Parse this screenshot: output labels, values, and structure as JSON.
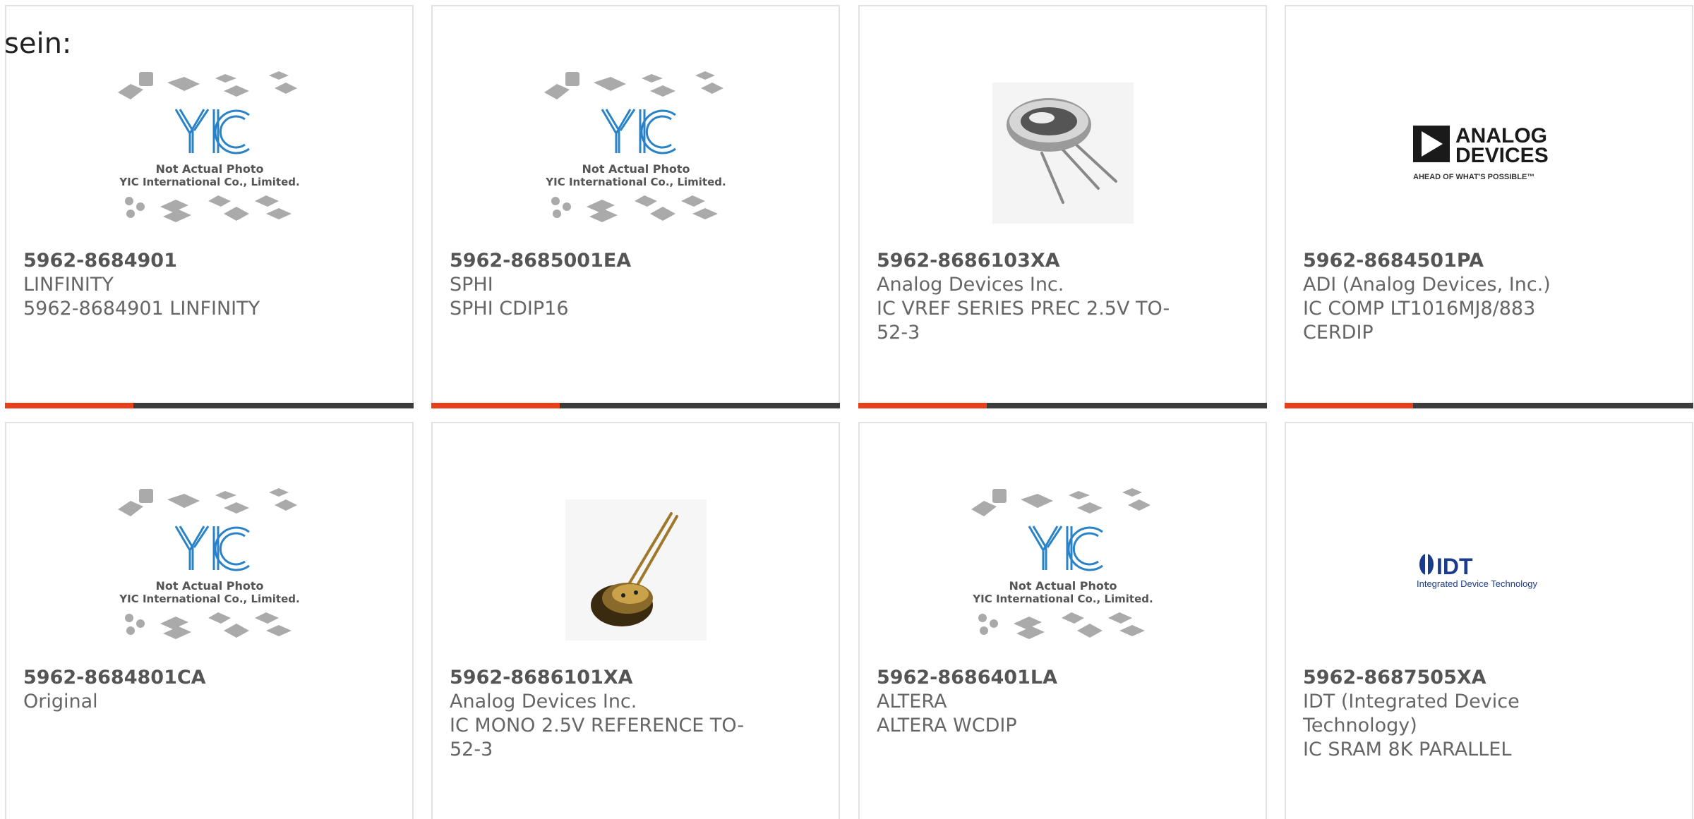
{
  "heading": "sein:",
  "colors": {
    "accent_bar": "#e8401c",
    "dark_bar": "#3c3c3c",
    "yic_blue": "#2a83c7",
    "analog_black": "#1a1a1a",
    "idt_blue": "#1b3c8c"
  },
  "placeholder": {
    "line1": "Not Actual Photo",
    "line2": "YIC International Co., Limited.",
    "logo_text": "YIC"
  },
  "analog_logo": {
    "line1": "ANALOG",
    "line2": "DEVICES",
    "tagline": "AHEAD OF WHAT'S POSSIBLE™"
  },
  "idt_logo": {
    "mark": "IDT",
    "tagline": "Integrated Device Technology"
  },
  "products": [
    {
      "part": "5962-8684901",
      "mfr": "LINFINITY",
      "desc": "5962-8684901 LINFINITY",
      "image": "placeholder-icon"
    },
    {
      "part": "5962-8685001EA",
      "mfr": "SPHI",
      "desc": "SPHI CDIP16",
      "image": "placeholder-icon"
    },
    {
      "part": "5962-8686103XA",
      "mfr": "Analog Devices Inc.",
      "desc": "IC VREF SERIES PREC 2.5V TO-52-3",
      "image": "to-can-photo"
    },
    {
      "part": "5962-8684501PA",
      "mfr": "ADI (Analog Devices, Inc.)",
      "desc": "IC COMP LT1016MJ8/883 CERDIP",
      "image": "analog-devices-logo"
    },
    {
      "part": "5962-8684801CA",
      "mfr": "Original",
      "desc": "",
      "image": "placeholder-icon"
    },
    {
      "part": "5962-8686101XA",
      "mfr": "Analog Devices Inc.",
      "desc": "IC MONO 2.5V REFERENCE TO-52-3",
      "image": "to52-photo"
    },
    {
      "part": "5962-8686401LA",
      "mfr": "ALTERA",
      "desc": "ALTERA WCDIP",
      "image": "placeholder-icon"
    },
    {
      "part": "5962-8687505XA",
      "mfr": "IDT (Integrated Device Technology)",
      "desc": "IC SRAM 8K PARALLEL",
      "image": "idt-logo"
    }
  ]
}
